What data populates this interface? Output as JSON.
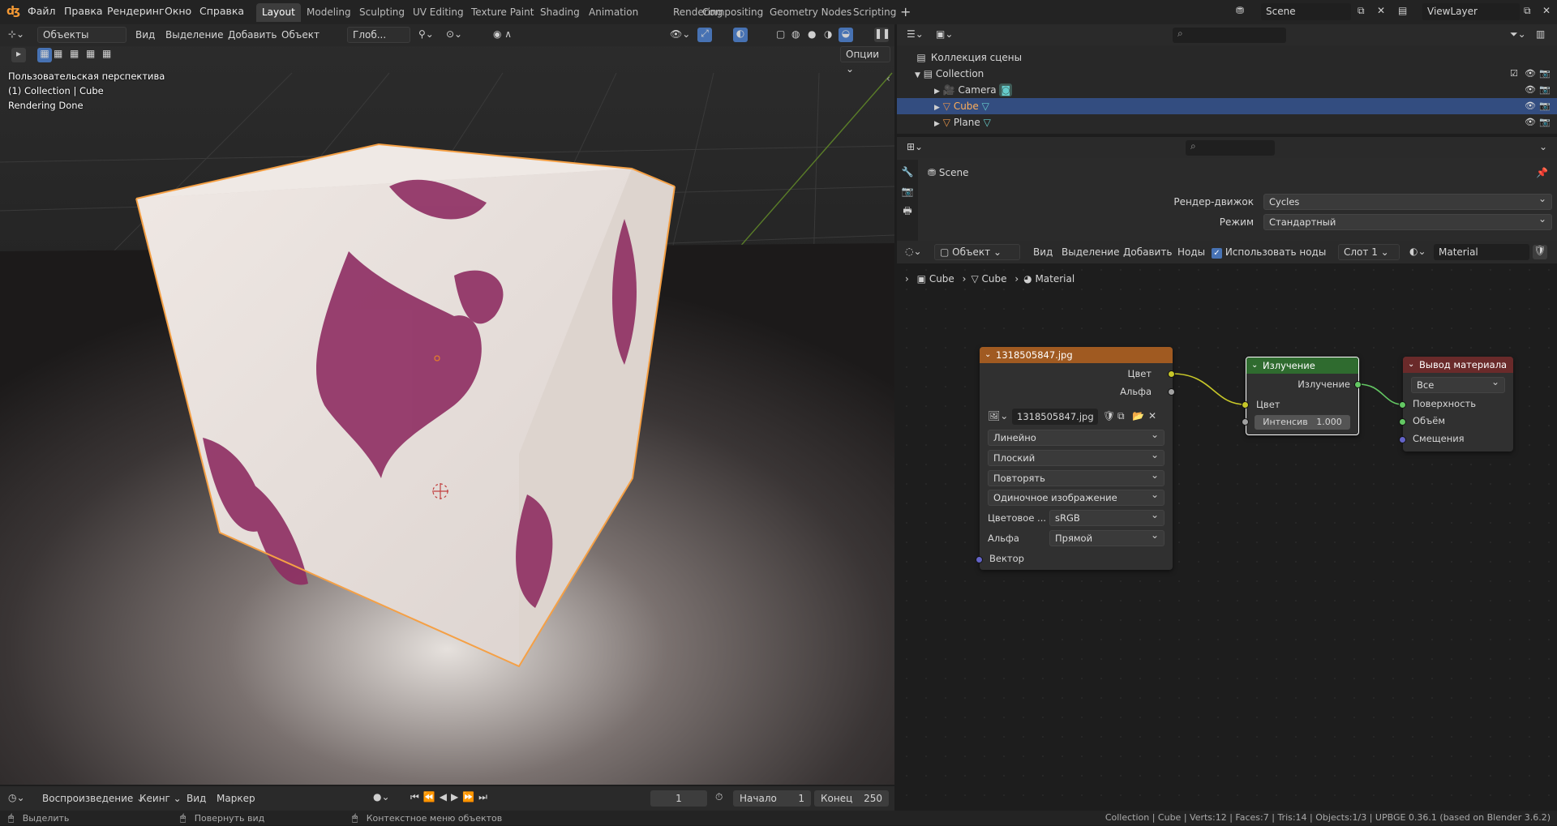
{
  "menu": {
    "items": [
      "Файл",
      "Правка",
      "Рендеринг",
      "Окно",
      "Справка"
    ]
  },
  "workspaces": [
    "Layout",
    "Modeling",
    "Sculpting",
    "UV Editing",
    "Texture Paint",
    "Shading",
    "Animation",
    "Rendering",
    "Compositing",
    "Geometry Nodes",
    "Scripting"
  ],
  "scene": {
    "name": "Scene",
    "view_layer": "ViewLayer"
  },
  "viewport": {
    "mode": "Объекты",
    "menus": [
      "Вид",
      "Выделение",
      "Добавить",
      "Объект"
    ],
    "transform": "Глоб...",
    "options": "Опции",
    "overlay_lines": [
      "Пользовательская перспектива",
      "(1) Collection | Cube",
      "Rendering Done"
    ]
  },
  "outliner": {
    "root": "Коллекция сцены",
    "collection": "Collection",
    "items": [
      {
        "name": "Camera"
      },
      {
        "name": "Cube"
      },
      {
        "name": "Plane"
      }
    ]
  },
  "properties": {
    "scene": "Scene",
    "engine_label": "Рендер-движок",
    "engine": "Cycles",
    "mode_label": "Режим",
    "mode": "Стандартный"
  },
  "node_editor": {
    "object_mode": "Объект",
    "menus": [
      "Вид",
      "Выделение",
      "Добавить",
      "Ноды"
    ],
    "use_nodes": "Использовать ноды",
    "slot": "Слот 1",
    "material": "Material",
    "breadcrumb": [
      "Cube",
      "Cube",
      "Material"
    ]
  },
  "image_node": {
    "title": "1318505847.jpg",
    "out_color": "Цвет",
    "out_alpha": "Альфа",
    "image": "1318505847.jpg",
    "interp": "Линейно",
    "proj": "Плоский",
    "ext": "Повторять",
    "source": "Одиночное изображение",
    "cs_label": "Цветовое ...",
    "cs": "sRGB",
    "alpha_label": "Альфа",
    "alpha": "Прямой",
    "vector": "Вектор"
  },
  "emission_node": {
    "title": "Излучение",
    "out": "Излучение",
    "in_color": "Цвет",
    "strength_label": "Интенсив",
    "strength": "1.000"
  },
  "output_node": {
    "title": "Вывод материала",
    "target": "Все",
    "surface": "Поверхность",
    "volume": "Объём",
    "displacement": "Смещения"
  },
  "timeline": {
    "playback": "Воспроизведение",
    "keying": "Кеинг",
    "view": "Вид",
    "marker": "Маркер",
    "frame": "1",
    "start_label": "Начало",
    "start": "1",
    "end_label": "Конец",
    "end": "250"
  },
  "statusbar": {
    "select": "Выделить",
    "rotate": "Повернуть вид",
    "context": "Контекстное меню объектов",
    "info": "Collection | Cube | Verts:12 | Faces:7 | Tris:14 | Objects:1/3 | UPBGE 0.36.1 (based on Blender 3.6.2)"
  },
  "colors": {
    "accent": "#4772b3",
    "selection": "#ff9a3c",
    "image_header": "#a05a21",
    "emission_header": "#2f6b2f",
    "output_header": "#6a2a2a",
    "socket_color": "#c7c729",
    "socket_shader": "#63c763",
    "socket_vector": "#6363c7",
    "socket_gray": "#a1a1a1"
  }
}
